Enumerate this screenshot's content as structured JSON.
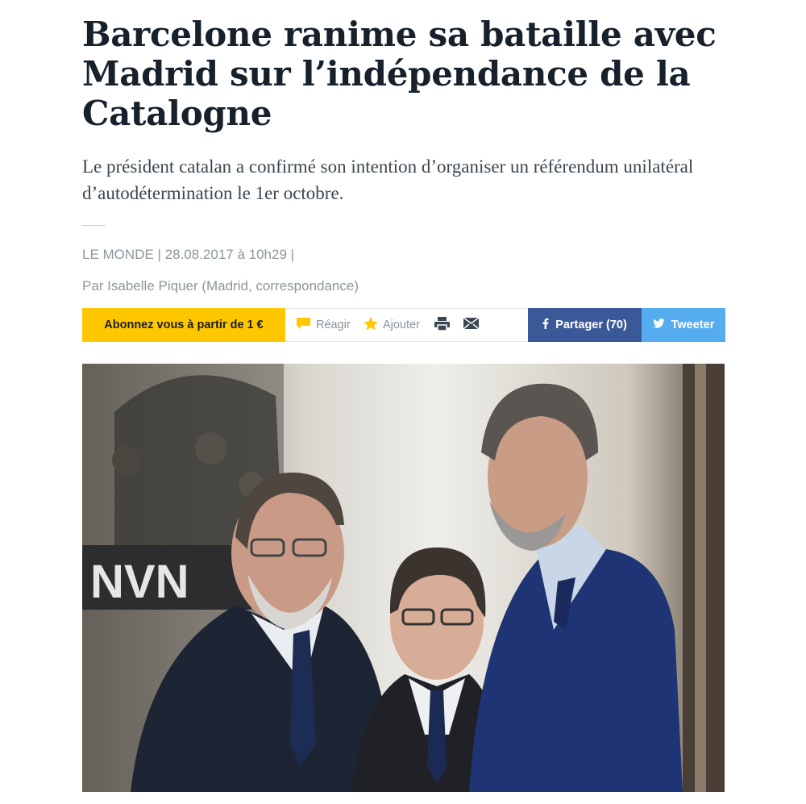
{
  "article": {
    "headline": "Barcelone ranime sa bataille avec Madrid sur l’indépendance de la Catalogne",
    "lede": "Le président catalan a confirmé son intention d’organiser un référendum unilatéral d’autodétermination le 1er octobre.",
    "meta": "LE MONDE | 28.08.2017 à 10h29 |",
    "author": "Par Isabelle Piquer (Madrid, correspondance)"
  },
  "toolbar": {
    "subscribe_label": "Abonnez vous à partir de 1 €",
    "react_label": "Réagir",
    "add_label": "Ajouter",
    "facebook_label": "Partager (70)",
    "twitter_label": "Tweeter",
    "icons": [
      "comment-icon",
      "star-icon",
      "print-icon",
      "mail-icon",
      "facebook-icon",
      "twitter-icon"
    ]
  },
  "colors": {
    "subscribe_bg": "#ffc700",
    "facebook_bg": "#3b5998",
    "twitter_bg": "#55acee",
    "headline": "#16212c",
    "meta": "#8d959c"
  },
  "photo": {
    "icon": "article-photo",
    "banner_text": "NVN"
  }
}
